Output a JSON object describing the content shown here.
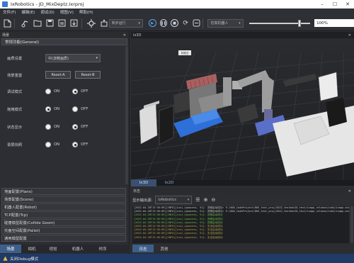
{
  "window": {
    "title": "IxRobotics - JD_MixDeptz.Ixrproj",
    "controls": {
      "minimize": "–",
      "maximize": "☐",
      "close": "✕"
    }
  },
  "menu": [
    "文件(F)",
    "编辑(E)",
    "调试(D)",
    "视图(V)",
    "帮助(H)"
  ],
  "toolbar": {
    "run_mode": "单步运行",
    "robot_select": "仿真机器人",
    "speed_percent": 85,
    "zoom_value": "100%"
  },
  "scene_panel": {
    "title": "场景",
    "section_title": "常规功能(General)",
    "rows": [
      {
        "label": "画质设置",
        "type": "select",
        "value": "中(流畅画质)"
      },
      {
        "label": "场景重置",
        "type": "buttons",
        "buttons": [
          "Reset-A",
          "Reset-B"
        ]
      },
      {
        "label": "调试模式",
        "type": "radio",
        "on": "ON",
        "off": "OFF",
        "selected": "off"
      },
      {
        "label": "拖拽模式",
        "type": "radio",
        "on": "ON",
        "off": "OFF",
        "selected": "on"
      },
      {
        "label": "状态显示",
        "type": "radio",
        "on": "ON",
        "off": "OFF",
        "selected": "off"
      },
      {
        "label": "录屏快照",
        "type": "radio",
        "on": "ON",
        "off": "OFF",
        "selected": "off"
      }
    ],
    "accordion": [
      "地面配置(Plane)",
      "场景配置(Scene)",
      "机器人配置(Robot)",
      "TCP配置(Tcp)",
      "碰撞模型配置(Collide Geom)",
      "托盘空间配置(Pallet)",
      "通用模型配置"
    ],
    "bottom_tabs": [
      "场景",
      "相机",
      "视觉",
      "机器人",
      "时序"
    ]
  },
  "view3d": {
    "title": "Ix3D",
    "label_tag": "0003",
    "tabs": [
      "Ix3D",
      "Ix2D"
    ]
  },
  "log_panel": {
    "title": "日志",
    "filter_label": "显示输出源:",
    "filter_value": "IxRobotics",
    "lines": [
      "[2022-04-28T13:36:09][INFO][ixui_ignocess, 51]: 进程启动成功: E:/000_CodeProject/005_test_proj/2022_testbot20_test/ixapp_release/ixb4/ixapp.exe 工作目录: E:/000_CodeProject/005_test_proj/2022_testbot20_test/ixapp_release/ixb4/",
      "[2022-04-28T13:36:09][INFO][ixui_ignocess, 51]: 进程启动成功: E:/000_CodeProject/005_test_proj/2022_testbot20_test/ixapp_release/ixb4/ixapp.exe 工作",
      "[2022-04-28T13:36:09][INFO][ixui_ignocess, 51]: 进程启动成功",
      "[2022-04-28T13:36:09][INFO][ixui_ignocess, 51]: 进程启动成功",
      "[2022-04-28T13:36:09][INFO][ixui_ignocess, 51]: 进程启动成功",
      "[2022-04-28T13:36:09][INFO][ixui_ignocess, 51]: 无法启动成功",
      "[2022-04-28T13:36:09][INFO][ixui_ignocess, 51]: 无法启动成功",
      "[2022-04-28T13:36:09][INFO][ixui_ignocess, 51]: 无法启动成功",
      "[2022-04-28T13:36:09][INFO][ixui_ignocess, 51]: 无法启动成功"
    ],
    "tabs": [
      "日志",
      "其他"
    ]
  },
  "status": {
    "text": "关闭Debug模式"
  },
  "colors": {
    "accent": "#3f5f8a",
    "status_bar": "#1f3b66",
    "log_first_line": "#c8c8c8",
    "log_info": "#6fbf4a",
    "log_warn": "#b8a44a"
  }
}
